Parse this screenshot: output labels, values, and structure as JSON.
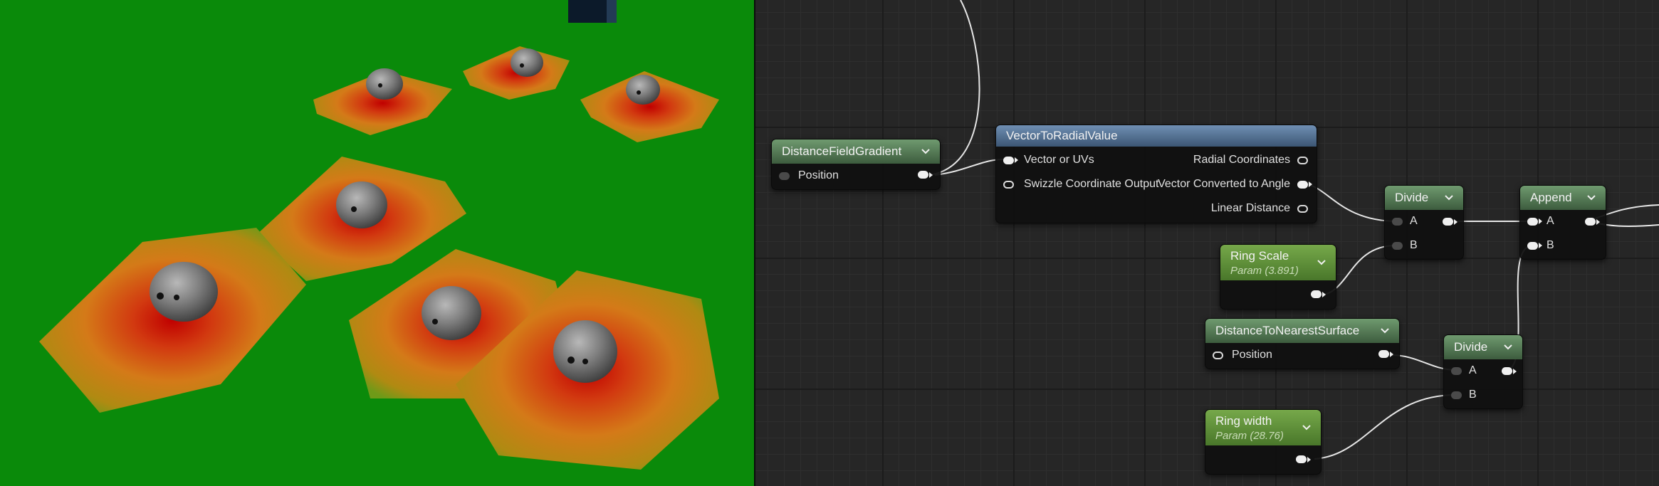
{
  "viewport": {
    "background": "#0a8a0a",
    "description_icon": "rock-icon"
  },
  "graph": {
    "nodes": {
      "distance_field_gradient": {
        "title": "DistanceFieldGradient",
        "output_label": "Position"
      },
      "vector_to_radial": {
        "title": "VectorToRadialValue",
        "input_1": "Vector or UVs",
        "input_2": "Swizzle Coordinate Output",
        "output_1": "Radial Coordinates",
        "output_2": "Vector Converted to Angle",
        "output_3": "Linear Distance"
      },
      "divide_1": {
        "title": "Divide",
        "in_a": "A",
        "in_b": "B"
      },
      "append": {
        "title": "Append",
        "in_a": "A",
        "in_b": "B"
      },
      "ring_scale": {
        "title": "Ring Scale",
        "subtitle": "Param (3.891)"
      },
      "distance_to_nearest": {
        "title": "DistanceToNearestSurface",
        "input_label": "Position"
      },
      "divide_2": {
        "title": "Divide",
        "in_a": "A",
        "in_b": "B"
      },
      "ring_width": {
        "title": "Ring width",
        "subtitle": "Param (28.76)"
      }
    },
    "colors": {
      "header_function": "#3d5c3e",
      "header_custom": "#3c5674",
      "header_param": "#49772a",
      "wire": "#e8e8e8"
    }
  }
}
